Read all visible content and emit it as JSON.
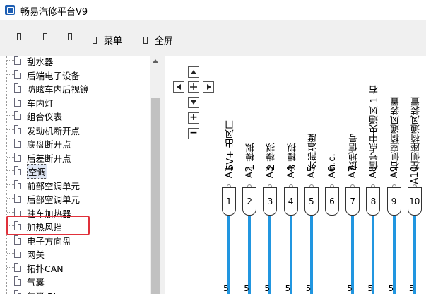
{
  "window": {
    "title": "畅易汽修平台V9",
    "accent": "#1e5fb4"
  },
  "toolbar": {
    "buttons": [
      {
        "label": "",
        "icon": "box-glyph"
      },
      {
        "label": "",
        "icon": "box-glyph"
      },
      {
        "label": "",
        "icon": "box-glyph"
      },
      {
        "label": "菜单",
        "icon": "box-glyph"
      },
      {
        "label": "全屏",
        "icon": "box-glyph"
      }
    ]
  },
  "tree": {
    "selected_index": 8,
    "items": [
      {
        "label": "刮水器"
      },
      {
        "label": "后端电子设备"
      },
      {
        "label": "防眩车内后视镜"
      },
      {
        "label": "车内灯"
      },
      {
        "label": "组合仪表"
      },
      {
        "label": "发动机断开点"
      },
      {
        "label": "底盘断开点"
      },
      {
        "label": "后差断开点"
      },
      {
        "label": "空调"
      },
      {
        "label": "前部空调单元"
      },
      {
        "label": "后部空调单元"
      },
      {
        "label": "驻车加热器"
      },
      {
        "label": "加热风挡"
      },
      {
        "label": "电子方向盘"
      },
      {
        "label": "网关"
      },
      {
        "label": "拓扑CAN"
      },
      {
        "label": "气囊"
      },
      {
        "label": "气囊 BL"
      }
    ],
    "highlight_color": "#e0303a"
  },
  "diagram": {
    "zoom_controls": [
      "up-arrow",
      "left-arrow",
      "center-cross",
      "right-arrow",
      "down-arrow",
      "zoom-in",
      "zoom-out"
    ],
    "zoom_in_label": "+",
    "zoom_out_label": "−",
    "wire_color": "#2196e0",
    "pins": [
      {
        "code": "A1",
        "name": "5V+ 出风口",
        "num": "1",
        "wire": "5"
      },
      {
        "code": "A2",
        "name": "1 模拟",
        "num": "2",
        "wire": "5"
      },
      {
        "code": "A3",
        "name": "2 模拟",
        "num": "3",
        "wire": "5"
      },
      {
        "code": "A4",
        "name": "3 模拟",
        "num": "4",
        "wire": "5"
      },
      {
        "code": "A5",
        "name": "外部温度",
        "num": "5",
        "wire": "5"
      },
      {
        "code": "A6",
        "name": "n.c.",
        "num": "6",
        "wire": ""
      },
      {
        "code": "A7",
        "name": "接地信号",
        "num": "7",
        "wire": "5"
      },
      {
        "code": "A8",
        "name": "信号点中央通风 1 右",
        "num": "8",
        "wire": "5"
      },
      {
        "code": "A9",
        "name": "右侧座椅通风装置",
        "num": "9",
        "wire": "5"
      },
      {
        "code": "A10",
        "name": "左侧座椅通风装置",
        "num": "10",
        "wire": "5"
      }
    ]
  }
}
